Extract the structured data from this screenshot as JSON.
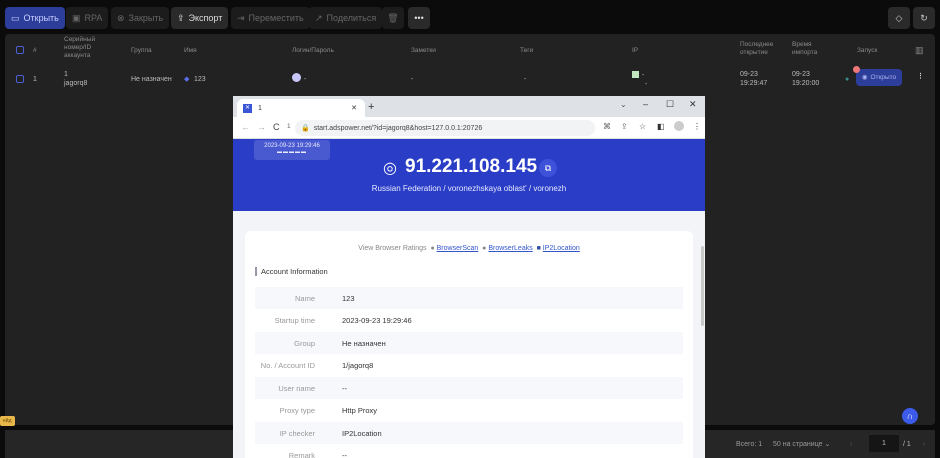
{
  "toolbar": {
    "open": "Открыть",
    "rpa": "RPA",
    "close": "Закрыть",
    "export": "Экспорт",
    "move": "Переместить",
    "share": "Поделиться",
    "more": "•••"
  },
  "table": {
    "headers": {
      "num": "#",
      "serial": "Серийный номер/ID аккаунта",
      "group": "Группа",
      "name": "Имя",
      "login": "Логин/Пароль",
      "notes": "Заметки",
      "tags": "Теги",
      "ip": "IP",
      "last_open": "Последнее открытие",
      "import_time": "Время импорта",
      "launch": "Запуск"
    },
    "rows": [
      {
        "num": "1",
        "serial": "1",
        "id": "jagorq8",
        "group": "Не назначен",
        "name": "123",
        "login": "-",
        "notes": "-",
        "tags": "-",
        "ip": "-",
        "ip2": "-",
        "last_open_date": "09-23",
        "last_open_time": "19:29:47",
        "import_date": "09-23",
        "import_time": "19:20:00",
        "launch_label": "Открыто"
      }
    ]
  },
  "side_badge": "ейд",
  "pagination": {
    "total": "Всего: 1",
    "per_page": "50 на странице",
    "page": "1",
    "pages": "/ 1"
  },
  "browser": {
    "tab_title": "1",
    "url_prefix": "1",
    "url": "start.adspower.net/?id=jagorq8&host=127.0.0.1:20726",
    "timestamp": "2023-09-23 19:29:46",
    "ip": "91.221.108.145",
    "location": "Russian Federation / voronezhskaya oblast' / voronezh",
    "ratings_label": "View Browser Ratings",
    "ratings": [
      "BrowserScan",
      "BrowserLeaks",
      "IP2Location"
    ],
    "section_title": "Account Information",
    "fields": [
      {
        "k": "Name",
        "v": "123"
      },
      {
        "k": "Startup time",
        "v": "2023-09-23 19:29:46"
      },
      {
        "k": "Group",
        "v": "Не назначен"
      },
      {
        "k": "No. / Account ID",
        "v": "1/jagorq8"
      },
      {
        "k": "User name",
        "v": "--"
      },
      {
        "k": "Proxy type",
        "v": "Http Proxy"
      },
      {
        "k": "IP checker",
        "v": "IP2Location"
      },
      {
        "k": "Remark",
        "v": "--"
      }
    ]
  },
  "colors": {
    "accent": "#2a3dc7",
    "primary_btn": "#2d3d9a"
  }
}
